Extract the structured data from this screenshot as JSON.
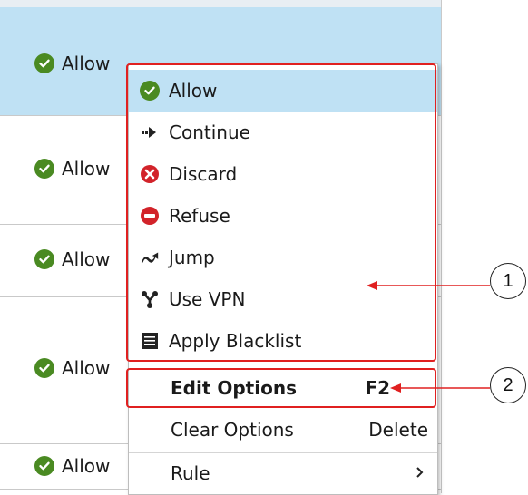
{
  "table": {
    "rows": [
      {
        "action": "Allow",
        "selected": true
      },
      {
        "action": "Allow",
        "selected": false
      },
      {
        "action": "Allow",
        "selected": false
      },
      {
        "action": "Allow",
        "selected": false
      },
      {
        "action": "Allow",
        "selected": false
      }
    ]
  },
  "context_menu": {
    "items": [
      {
        "label": "Allow",
        "icon": "check-circle-icon",
        "highlighted": true
      },
      {
        "label": "Continue",
        "icon": "arrow-right-icon"
      },
      {
        "label": "Discard",
        "icon": "x-circle-icon"
      },
      {
        "label": "Refuse",
        "icon": "minus-circle-icon"
      },
      {
        "label": "Jump",
        "icon": "jump-arrow-icon"
      },
      {
        "label": "Use VPN",
        "icon": "vpn-icon"
      },
      {
        "label": "Apply Blacklist",
        "icon": "blacklist-icon"
      },
      {
        "label": "Edit Options",
        "shortcut": "F2",
        "bold": true
      },
      {
        "label": "Clear Options",
        "shortcut": "Delete"
      },
      {
        "label": "Rule",
        "submenu": true,
        "icon": "chevron-right-icon"
      }
    ]
  },
  "annotations": {
    "callout_1": "1",
    "callout_2": "2"
  },
  "colors": {
    "highlight": "#bfe1f4",
    "allow_green": "#4a8a22",
    "discard_red": "#d2232a",
    "annotation_red": "#e02020"
  }
}
